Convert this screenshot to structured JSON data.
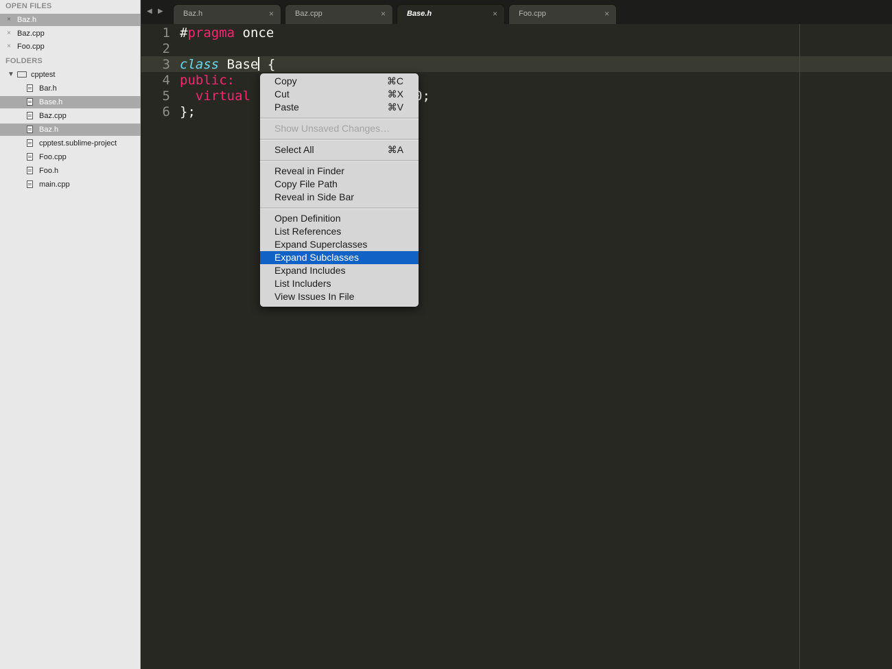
{
  "sidebar": {
    "open_files_title": "OPEN FILES",
    "folders_title": "FOLDERS",
    "open_files": [
      {
        "label": "Baz.h",
        "close": "×"
      },
      {
        "label": "Baz.cpp",
        "close": "×"
      },
      {
        "label": "Foo.cpp",
        "close": "×"
      }
    ],
    "folder": {
      "label": "cpptest",
      "expand": "▼"
    },
    "files": [
      {
        "label": "Bar.h"
      },
      {
        "label": "Base.h"
      },
      {
        "label": "Baz.cpp"
      },
      {
        "label": "Baz.h"
      },
      {
        "label": "cpptest.sublime-project"
      },
      {
        "label": "Foo.cpp"
      },
      {
        "label": "Foo.h"
      },
      {
        "label": "main.cpp"
      }
    ]
  },
  "tabbar": {
    "prev": "◀",
    "next": "▶",
    "tabs": [
      {
        "label": "Baz.h",
        "close": "×"
      },
      {
        "label": "Baz.cpp",
        "close": "×"
      },
      {
        "label": "Base.h",
        "close": "×"
      },
      {
        "label": "Foo.cpp",
        "close": "×"
      }
    ]
  },
  "editor": {
    "line_numbers": [
      "1",
      "2",
      "3",
      "4",
      "5",
      "6"
    ],
    "line1": {
      "hash": "#",
      "pragma": "pragma",
      "rest": " once"
    },
    "line3": {
      "class_kw": "class",
      "name": " Base",
      "brace": " {"
    },
    "line4": {
      "public": "public:"
    },
    "line5": {
      "indent": "  ",
      "virtual": "virtual",
      "hidden_space": " ",
      "tail": "0;"
    },
    "line6": {
      "close": "};"
    }
  },
  "context_menu": {
    "items": [
      {
        "label": "Copy",
        "shortcut": "⌘C"
      },
      {
        "label": "Cut",
        "shortcut": "⌘X"
      },
      {
        "label": "Paste",
        "shortcut": "⌘V"
      },
      {
        "label": "Show Unsaved Changes…",
        "shortcut": ""
      },
      {
        "label": "Select All",
        "shortcut": "⌘A"
      },
      {
        "label": "Reveal in Finder",
        "shortcut": ""
      },
      {
        "label": "Copy File Path",
        "shortcut": ""
      },
      {
        "label": "Reveal in Side Bar",
        "shortcut": ""
      },
      {
        "label": "Open Definition",
        "shortcut": ""
      },
      {
        "label": "List References",
        "shortcut": ""
      },
      {
        "label": "Expand Superclasses",
        "shortcut": ""
      },
      {
        "label": "Expand Subclasses",
        "shortcut": ""
      },
      {
        "label": "Expand Includes",
        "shortcut": ""
      },
      {
        "label": "List Includers",
        "shortcut": ""
      },
      {
        "label": "View Issues In File",
        "shortcut": ""
      }
    ]
  },
  "colors": {
    "keyword": "#f92672",
    "storage": "#66d9ef",
    "highlight": "#1162c5",
    "editor_bg": "#272822"
  }
}
